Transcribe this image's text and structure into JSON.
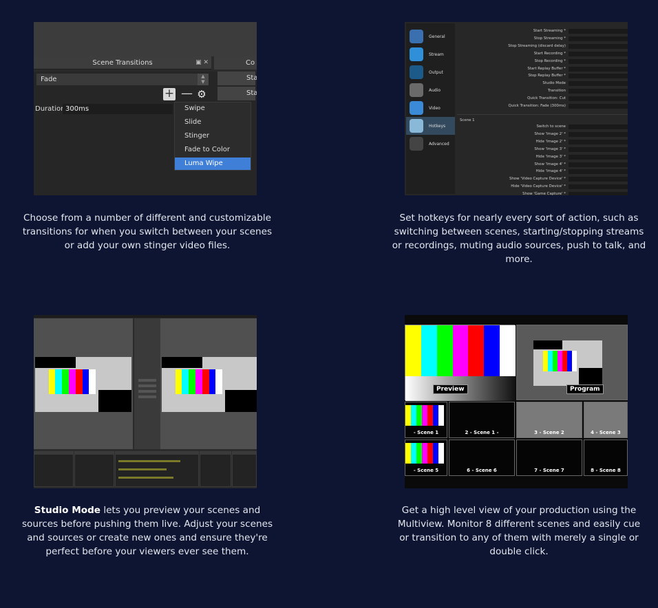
{
  "features": [
    {
      "id": "transitions",
      "caption": "Choose from a number of different and customizable transitions for when you switch between your scenes or add your own stinger video files.",
      "screenshot": {
        "panel_title": "Scene Transitions",
        "controls_title": "Co",
        "header_icons": "▣ ✕",
        "selected_transition": "Fade",
        "add_icon": "+",
        "remove_icon": "—",
        "settings_icon": "⚙",
        "duration_label": "Duration",
        "duration_value": "300ms",
        "start_buttons": [
          "Star",
          "Star"
        ],
        "menu_items": [
          "Swipe",
          "Slide",
          "Stinger",
          "Fade to Color",
          "Luma Wipe"
        ],
        "menu_selected": "Luma Wipe"
      }
    },
    {
      "id": "hotkeys",
      "caption": "Set hotkeys for nearly every sort of action, such as switching between scenes, starting/stopping streams or recordings, muting audio sources, push to talk, and more.",
      "screenshot": {
        "sidebar": [
          {
            "label": "General",
            "icon": "general-icon",
            "color": "#3a6fb0"
          },
          {
            "label": "Stream",
            "icon": "stream-globe-icon",
            "color": "#2f8fd8"
          },
          {
            "label": "Output",
            "icon": "output-icon",
            "color": "#1c5a8a"
          },
          {
            "label": "Audio",
            "icon": "audio-icon",
            "color": "#6a6a6a"
          },
          {
            "label": "Video",
            "icon": "video-monitor-icon",
            "color": "#3a8ad8"
          },
          {
            "label": "Hotkeys",
            "icon": "hotkeys-keyboard-icon",
            "color": "#8ab8d8"
          },
          {
            "label": "Advanced",
            "icon": "advanced-gears-icon",
            "color": "#444444"
          }
        ],
        "selected": "Hotkeys",
        "global_keys": [
          "Start Streaming *",
          "Stop Streaming *",
          "Stop Streaming (discard delay)",
          "Start Recording *",
          "Stop Recording *",
          "Start Replay Buffer *",
          "Stop Replay Buffer *",
          "Studio Mode",
          "Transition",
          "Quick Transition: Cut",
          "Quick Transition: Fade (300ms)"
        ],
        "scene_label": "Scene 1",
        "scene_keys": [
          "Switch to scene",
          "Show 'Image 2' *",
          "Hide 'Image 2' *",
          "Show 'Image 3' *",
          "Hide 'Image 3' *",
          "Show 'Image 4' *",
          "Hide 'Image 4' *",
          "Show 'Video Capture Device' *",
          "Hide 'Video Capture Device' *",
          "Show 'Game Capture' *"
        ]
      }
    },
    {
      "id": "studio-mode",
      "caption_bold": "Studio Mode",
      "caption_rest": " lets you preview your scenes and sources before pushing them live. Adjust your scenes and sources or create new ones and ensure they're perfect before your viewers ever see them."
    },
    {
      "id": "multiview",
      "caption": "Get a high level view of your production using the Multiview. Monitor 8 different scenes and easily cue or transition to any of them with merely a single or double click.",
      "screenshot": {
        "preview_label": "Preview",
        "program_label": "Program",
        "scene_labels": [
          "- Scene 1",
          "2 - Scene 1 -",
          "3 - Scene 2",
          "4 - Scene 3",
          "- Scene 5",
          "6 - Scene 6",
          "7 - Scene 7",
          "8 - Scene 8"
        ]
      }
    }
  ],
  "colors": {
    "background": "#0d1532",
    "caption_text": "#e3e6ee",
    "selected_menu": "#3f7fd8",
    "bars": [
      "#ffff00",
      "#00ffff",
      "#00ff00",
      "#ff00ff",
      "#ff0000",
      "#0000ff",
      "#ffffff"
    ]
  }
}
